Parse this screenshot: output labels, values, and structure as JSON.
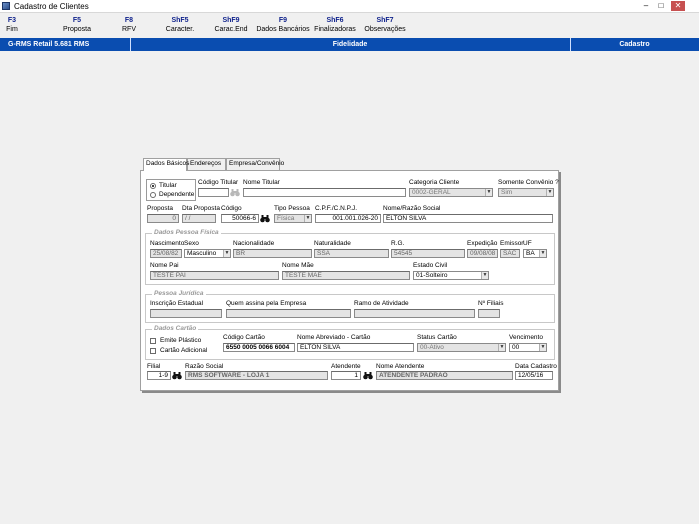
{
  "window": {
    "title": "Cadastro de Clientes",
    "minimize": "–",
    "maximize": "□",
    "close": "✕"
  },
  "toolbar": [
    {
      "key": "F3",
      "label": "Fim"
    },
    {
      "key": "F5",
      "label": "Proposta"
    },
    {
      "key": "F8",
      "label": "RFV"
    },
    {
      "key": "ShF5",
      "label": "Caracter."
    },
    {
      "key": "ShF9",
      "label": "Carac.End"
    },
    {
      "key": "F9",
      "label": "Dados Bancários"
    },
    {
      "key": "ShF6",
      "label": "Finalizadoras"
    },
    {
      "key": "ShF7",
      "label": "Observações"
    }
  ],
  "status": {
    "left": "G-RMS Retail 5.681 RMS",
    "center": "Fidelidade",
    "right": "Cadastro"
  },
  "tabs": [
    {
      "label": "Dados Básicos",
      "active": true
    },
    {
      "label": "Endereços",
      "active": false
    },
    {
      "label": "Empresa/Convênio",
      "active": false
    }
  ],
  "form": {
    "titular": "Titular",
    "dependente": "Dependente",
    "codigo_titular_label": "Código Titular",
    "codigo_titular": "",
    "nome_titular_label": "Nome Titular",
    "nome_titular": "",
    "categoria_label": "Categoria Cliente",
    "categoria": "0002-GERAL",
    "somente_convenio_label": "Somente Convênio ?",
    "somente_convenio": "Sim",
    "proposta_label": "Proposta",
    "proposta": "0",
    "dta_proposta_label": "Dta Proposta",
    "dta_proposta": "/ /",
    "codigo_label": "Código",
    "codigo": "50066-6",
    "tipo_pessoa_label": "Tipo Pessoa",
    "tipo_pessoa": "Física",
    "cpf_label": "C.P.F./C.N.P.J.",
    "cpf": "001.001.026-20",
    "nome_razao_label": "Nome/Razão Social",
    "nome_razao": "ELTON SILVA",
    "pf_title": "Dados Pessoa Física",
    "nascimento_label": "Nascimento",
    "nascimento": "25/08/82",
    "sexo_label": "Sexo",
    "sexo": "Masculino",
    "nacionalidade_label": "Nacionalidade",
    "nacionalidade": "BR",
    "naturalidade_label": "Naturalidade",
    "naturalidade": "SSA",
    "rg_label": "R.G.",
    "rg": "54545",
    "expedicao_label": "Expedição",
    "expedicao": "09/08/08",
    "emissor_label": "Emissor",
    "emissor": "SAC",
    "uf_label": "UF",
    "uf": "BA",
    "nome_pai_label": "Nome Pai",
    "nome_pai": "TESTE PAI",
    "nome_mae_label": "Nome Mãe",
    "nome_mae": "TESTE MAE",
    "estado_civil_label": "Estado Civil",
    "estado_civil": "01-Solteiro",
    "pj_title": "Pessoa Jurídica",
    "inscricao_label": "Inscrição Estadual",
    "inscricao": "",
    "quem_assina_label": "Quem assina pela Empresa",
    "quem_assina": "",
    "ramo_label": "Ramo de Atividade",
    "ramo": "",
    "num_filiais_label": "Nº Filiais",
    "num_filiais": "",
    "cartao_title": "Dados Cartão",
    "emite_plastico": "Emite Plástico",
    "cartao_adicional": "Cartão Adicional",
    "codigo_cartao_label": "Código Cartão",
    "codigo_cartao": "6550 0005 0066 6004",
    "nome_abreviado_label": "Nome Abreviado - Cartão",
    "nome_abreviado": "ELTON SILVA",
    "status_cartao_label": "Status Cartão",
    "status_cartao": "00-Ativo",
    "vencimento_label": "Vencimento",
    "vencimento": "00",
    "filial_label": "Filial",
    "filial": "1-9",
    "razao_social_label": "Razão Social",
    "razao_social": "RMS SOFTWARE - LOJA 1",
    "atendente_label": "Atendente",
    "atendente": "1",
    "nome_atendente_label": "Nome Atendente",
    "nome_atendente": "ATENDENTE PADRAO",
    "data_cadastro_label": "Data Cadastro",
    "data_cadastro": "12/05/16"
  },
  "icons": {
    "binoculars": "binoculars-icon",
    "app": "app-icon"
  }
}
